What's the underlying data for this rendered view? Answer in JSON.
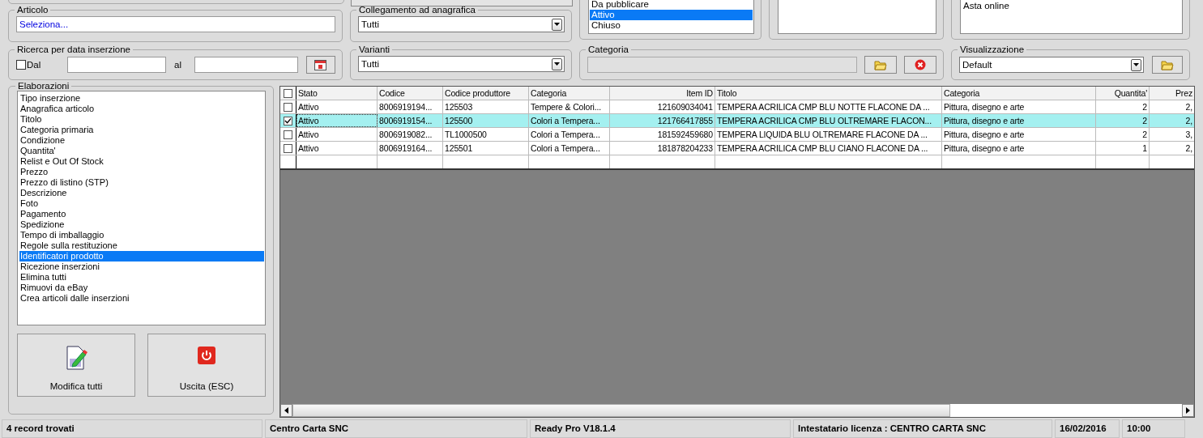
{
  "articolo": {
    "label": "Articolo",
    "value": "Seleziona..."
  },
  "collegamento": {
    "label": "Collegamento ad anagrafica",
    "value": "Tutti"
  },
  "stato_list": [
    {
      "label": "Da pubblicare",
      "selected": false
    },
    {
      "label": "Attivo",
      "selected": true
    },
    {
      "label": "Chiuso",
      "selected": false
    }
  ],
  "formato_list": [
    {
      "label": "Asta online",
      "selected": false
    }
  ],
  "ricerca": {
    "label": "Ricerca per data inserzione",
    "dal_label": "Dal",
    "dal_checked": false,
    "al_label": "al"
  },
  "varianti": {
    "label": "Varianti",
    "value": "Tutti"
  },
  "categoria": {
    "label": "Categoria"
  },
  "visualizzazione": {
    "label": "Visualizzazione",
    "value": "Default"
  },
  "elaborazioni": {
    "label": "Elaborazioni",
    "items": [
      {
        "label": "Tipo inserzione",
        "selected": false
      },
      {
        "label": "Anagrafica articolo",
        "selected": false
      },
      {
        "label": "Titolo",
        "selected": false
      },
      {
        "label": "Categoria primaria",
        "selected": false
      },
      {
        "label": "Condizione",
        "selected": false
      },
      {
        "label": "Quantita'",
        "selected": false
      },
      {
        "label": "Relist e Out Of Stock",
        "selected": false
      },
      {
        "label": "Prezzo",
        "selected": false
      },
      {
        "label": "Prezzo di listino (STP)",
        "selected": false
      },
      {
        "label": "Descrizione",
        "selected": false
      },
      {
        "label": "Foto",
        "selected": false
      },
      {
        "label": "Pagamento",
        "selected": false
      },
      {
        "label": "Spedizione",
        "selected": false
      },
      {
        "label": "Tempo di imballaggio",
        "selected": false
      },
      {
        "label": "Regole sulla restituzione",
        "selected": false
      },
      {
        "label": "Identificatori prodotto",
        "selected": true
      },
      {
        "label": "Ricezione inserzioni",
        "selected": false
      },
      {
        "label": "Elimina tutti",
        "selected": false
      },
      {
        "label": "Rimuovi da eBay",
        "selected": false
      },
      {
        "label": "Crea articoli dalle inserzioni",
        "selected": false
      }
    ]
  },
  "buttons": [
    {
      "kind": "edit",
      "label": "Modifica tutti"
    },
    {
      "kind": "exit",
      "label": "Uscita (ESC)"
    }
  ],
  "table": {
    "all_checked": false,
    "columns": [
      "Stato",
      "Codice",
      "Codice produttore",
      "Categoria",
      "Item ID",
      "Titolo",
      "Categoria",
      "Quantita'",
      "Prez"
    ],
    "rows": [
      {
        "checked": false,
        "selected": false,
        "cells": [
          "Attivo",
          "8006919194...",
          "125503",
          "Tempere & Colori...",
          "121609034041",
          "TEMPERA ACRILICA CMP BLU NOTTE FLACONE DA ...",
          "Pittura, disegno e arte",
          "2",
          "2,"
        ]
      },
      {
        "checked": true,
        "selected": true,
        "cells": [
          "Attivo",
          "8006919154...",
          "125500",
          "Colori a Tempera...",
          "121766417855",
          "TEMPERA ACRILICA CMP BLU OLTREMARE FLACON...",
          "Pittura, disegno e arte",
          "2",
          "2,"
        ]
      },
      {
        "checked": false,
        "selected": false,
        "cells": [
          "Attivo",
          "8006919082...",
          "TL1000500",
          "Colori a Tempera...",
          "181592459680",
          "TEMPERA LIQUIDA BLU OLTREMARE FLACONE DA ...",
          "Pittura, disegno e arte",
          "2",
          "3,"
        ]
      },
      {
        "checked": false,
        "selected": false,
        "cells": [
          "Attivo",
          "8006919164...",
          "125501",
          "Colori a Tempera...",
          "181878204233",
          "TEMPERA ACRILICA CMP BLU CIANO FLACONE DA ...",
          "Pittura, disegno e arte",
          "1",
          "2,"
        ]
      }
    ]
  },
  "status_bar": [
    "4 record trovati",
    "Centro Carta SNC",
    "Ready Pro V18.1.4",
    "Intestatario licenza : CENTRO CARTA SNC",
    "16/02/2016",
    "10:00"
  ]
}
